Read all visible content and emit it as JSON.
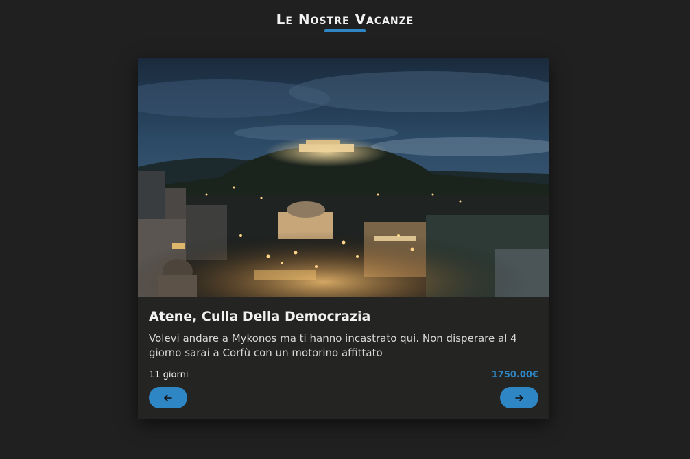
{
  "header": {
    "title": "Le Nostre Vacanze"
  },
  "trip": {
    "image_subject": "Athens at night with the Acropolis",
    "title": "Atene, Culla Della Democrazia",
    "description": "Volevi andare a Mykonos ma ti hanno incastrato qui. Non disperare al 4 giorno sarai a Corfù con un motorino affittato",
    "duration": "11 giorni",
    "price": "1750.00€"
  },
  "navigation": {
    "prev_icon": "arrow-left-icon",
    "next_icon": "arrow-right-icon"
  },
  "colors": {
    "background": "#202020",
    "card": "#242422",
    "accent": "#2f86c4"
  }
}
